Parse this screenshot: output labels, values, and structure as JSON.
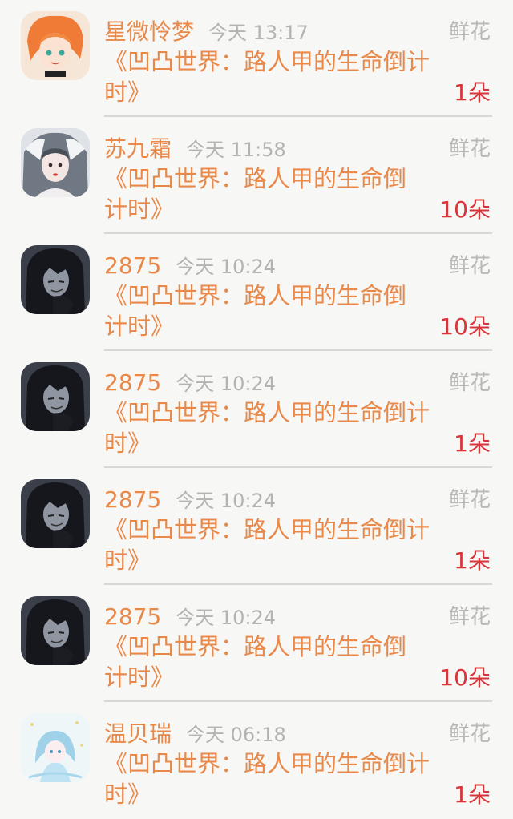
{
  "gifts": [
    {
      "name": "星微怜梦",
      "time": "今天 13:17",
      "type": "鲜花",
      "book": "《凹凸世界：路人甲的生命倒计时》",
      "count": "1朵",
      "book_width": 430,
      "avatar": "avatar-orange-hair"
    },
    {
      "name": "苏九霜",
      "time": "今天 11:58",
      "type": "鲜花",
      "book": "《凹凸世界：路人甲的生命倒计时》",
      "count": "10朵",
      "book_width": 400,
      "avatar": "avatar-white-hair"
    },
    {
      "name": "2875",
      "time": "今天 10:24",
      "type": "鲜花",
      "book": "《凹凸世界：路人甲的生命倒计时》",
      "count": "10朵",
      "book_width": 400,
      "avatar": "avatar-dark-hair"
    },
    {
      "name": "2875",
      "time": "今天 10:24",
      "type": "鲜花",
      "book": "《凹凸世界：路人甲的生命倒计时》",
      "count": "1朵",
      "book_width": 430,
      "avatar": "avatar-dark-hair"
    },
    {
      "name": "2875",
      "time": "今天 10:24",
      "type": "鲜花",
      "book": "《凹凸世界：路人甲的生命倒计时》",
      "count": "1朵",
      "book_width": 430,
      "avatar": "avatar-dark-hair"
    },
    {
      "name": "2875",
      "time": "今天 10:24",
      "type": "鲜花",
      "book": "《凹凸世界：路人甲的生命倒计时》",
      "count": "10朵",
      "book_width": 400,
      "avatar": "avatar-dark-hair"
    },
    {
      "name": "温贝瑞",
      "time": "今天 06:18",
      "type": "鲜花",
      "book": "《凹凸世界：路人甲的生命倒计时》",
      "count": "1朵",
      "book_width": 430,
      "avatar": "avatar-blue-anime"
    }
  ]
}
